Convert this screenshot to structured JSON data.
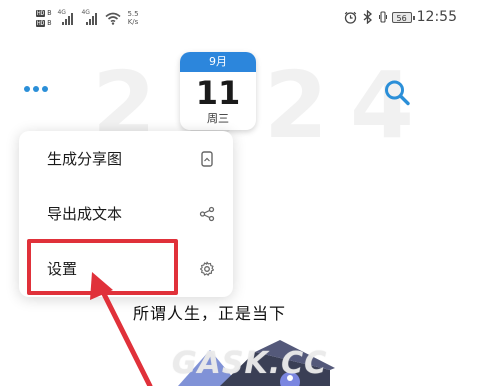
{
  "status_bar": {
    "sim1": "HD",
    "sim1_b": "B",
    "sim2": "HD",
    "sim2_b": "B",
    "net1": "4G",
    "net2": "4G",
    "speed_value": "5.5",
    "speed_unit": "K/s",
    "battery": "56",
    "time": "12:55"
  },
  "calendar": {
    "month": "9月",
    "day": "11",
    "weekday": "周三",
    "accent": "#2c86dc"
  },
  "year_watermark": "2024",
  "menu": {
    "items": [
      {
        "label": "生成分享图",
        "icon": "share-image-icon"
      },
      {
        "label": "导出成文本",
        "icon": "share-icon"
      },
      {
        "label": "设置",
        "icon": "gear-icon"
      }
    ]
  },
  "quote": "所谓人生，正是当下",
  "watermark": "GASK.CC",
  "colors": {
    "accent_blue": "#2b8fd8",
    "highlight_red": "#e0313a"
  }
}
